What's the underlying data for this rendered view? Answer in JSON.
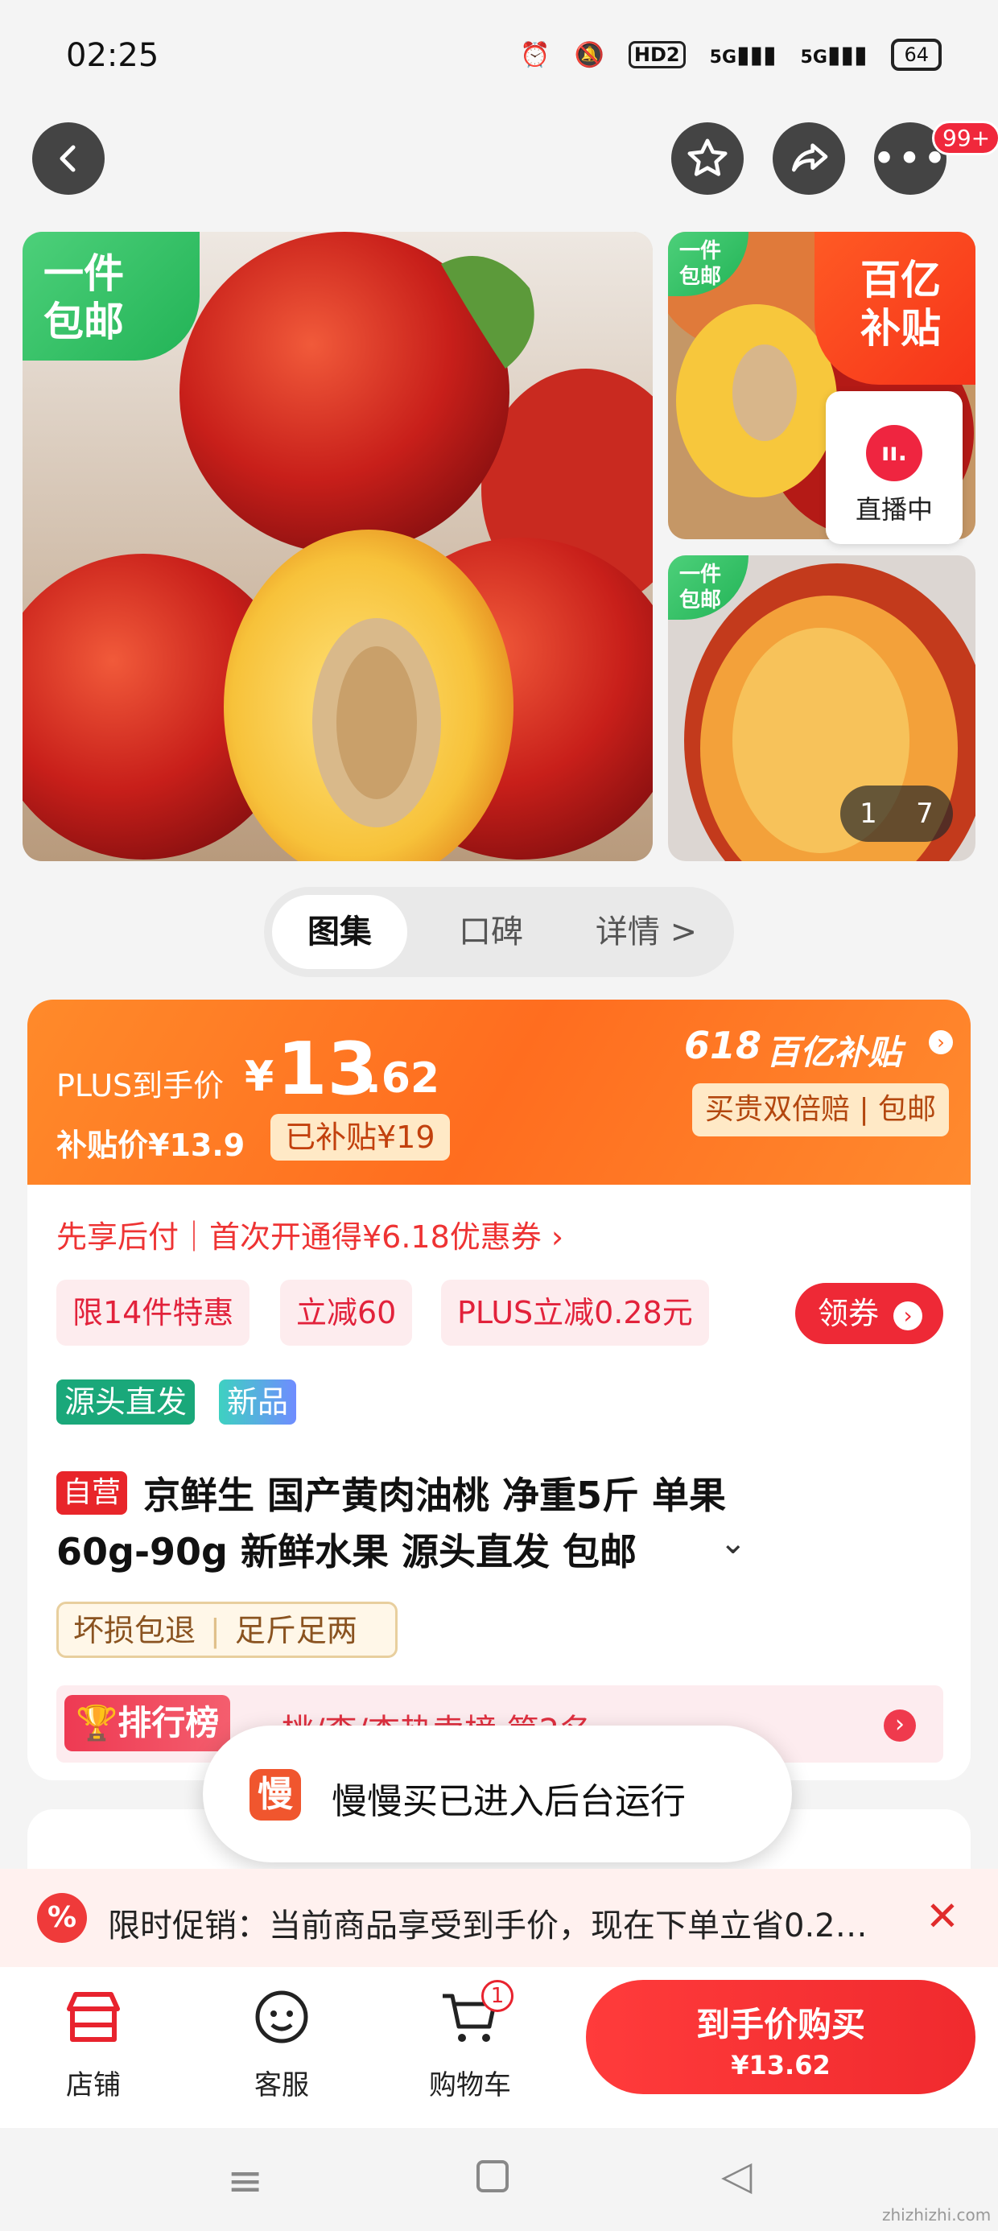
{
  "status_bar": {
    "time": "02:25",
    "network_hd": "HD2",
    "signal1": "5G",
    "signal2": "5G",
    "battery": "64"
  },
  "nav": {
    "more_badge": "99+"
  },
  "gallery": {
    "main_tag_line1": "一件",
    "main_tag_line2": "包邮",
    "thumb1_tag_line1": "一件",
    "thumb1_tag_line2": "包邮",
    "thumb2_tag_line1": "一件",
    "thumb2_tag_line2": "包邮",
    "subsidy_line1": "百亿",
    "subsidy_line2": "补贴",
    "live_label": "直播中",
    "counter_current": "1",
    "counter_total": "7"
  },
  "tabs": [
    {
      "label": "图集"
    },
    {
      "label": "口碑"
    },
    {
      "label": "详情 >"
    }
  ],
  "price": {
    "plus_label": "PLUS到手价",
    "currency": "¥",
    "integer": "13",
    "decimal": ".62",
    "subsidy_price_label": "补贴价¥13.9",
    "subsidized": "已补贴¥19",
    "campaign": "618",
    "campaign_brand": "百亿补贴",
    "guarantee": "买贵双倍赔 | 包邮"
  },
  "paylater": "先享后付｜首次开通得¥6.18优惠券 ›",
  "coupons": [
    "限14件特惠",
    "立减60",
    "PLUS立减0.28元"
  ],
  "coupon_button": "领券",
  "tags": {
    "source": "源头直发",
    "new": "新品"
  },
  "product": {
    "self_badge": "自营",
    "title_line1": "京鲜生  国产黄肉油桃 净重5斤 单果",
    "title_line2": "60g-90g 新鲜水果 源头直发 包邮"
  },
  "rules": [
    "坏损包退",
    "足斤足两"
  ],
  "ranking": {
    "label": "排行榜",
    "text": "桃/李/杏热卖榜 第2名"
  },
  "toast": {
    "icon_char": "慢",
    "text": "慢慢买已进入后台运行"
  },
  "promo": {
    "icon": "%",
    "text": "限时促销：当前商品享受到手价，现在下单立省0.2…"
  },
  "bottom_nav": {
    "shop": "店铺",
    "service": "客服",
    "cart": "购物车",
    "cart_count": "1"
  },
  "buy_button": {
    "title": "到手价购买",
    "price": "¥13.62"
  },
  "watermark": "zhizhizhi.com"
}
